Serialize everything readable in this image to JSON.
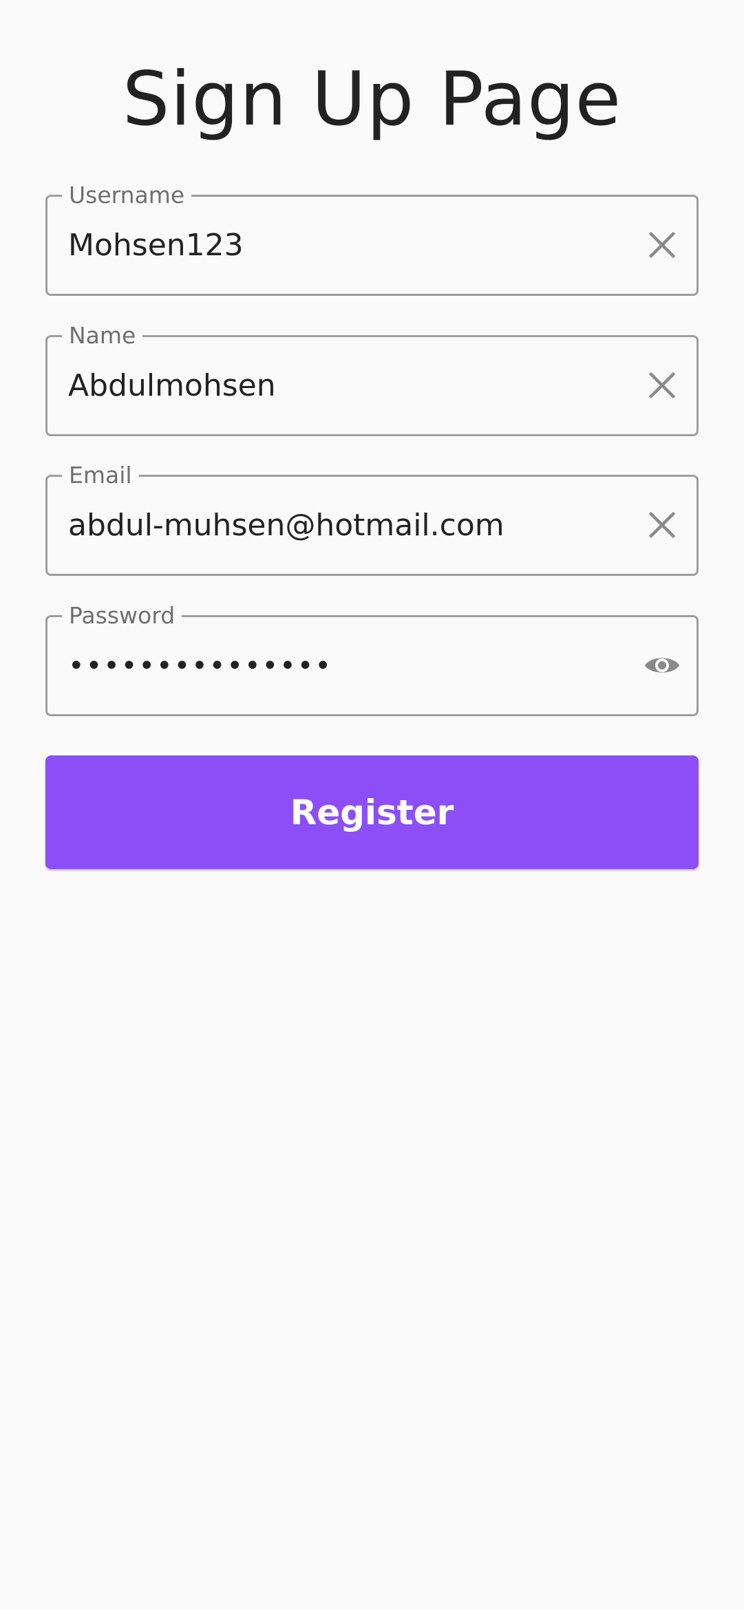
{
  "page": {
    "title": "Sign Up Page"
  },
  "form": {
    "username": {
      "label": "Username",
      "value": "Mohsen123",
      "icon": "clear-icon"
    },
    "name": {
      "label": "Name",
      "value": "Abdulmohsen",
      "icon": "clear-icon"
    },
    "email": {
      "label": "Email",
      "value": "abdul-muhsen@hotmail.com",
      "icon": "clear-icon"
    },
    "password": {
      "label": "Password",
      "value": "•••••••••••••••",
      "icon": "visibility-icon"
    },
    "register_label": "Register"
  },
  "colors": {
    "background": "#fafafa",
    "accent": "#8c4ff7",
    "border": "#9e9e9e",
    "icon": "#8a8a8a",
    "text": "#222222",
    "label": "#6f6f6f"
  }
}
